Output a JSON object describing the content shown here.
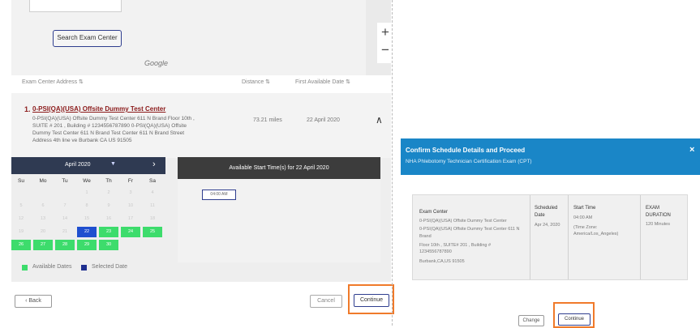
{
  "map": {
    "search_button": "Search Exam Center",
    "google_logo": "Google",
    "zoom_in": "+",
    "zoom_out": "−"
  },
  "table_headers": {
    "address": "Exam Center Address ⇅",
    "distance": "Distance ⇅",
    "first_date": "First Available Date ⇅"
  },
  "result": {
    "number": "1.",
    "name": "0-PSI(QA)(USA) Offsite Dummy Test Center",
    "address_lines": [
      "0-PSI(QA)(USA) Offsite Dummy Test Center 611 N Brand Floor 10th ,",
      "SUITE # 201 , Building # 1234556787890 0-PSI(QA)(USA) Offsite",
      "Dummy Test Center 611 N Brand Test Center 611 N Brand Street",
      "Address 4th line ve Burbank CA US 91505"
    ],
    "distance": "73.21 miles",
    "first_date": "22 April 2020",
    "collapse_glyph": "∧"
  },
  "calendar": {
    "month": "April 2020",
    "dropdown_glyph": "▼",
    "next_glyph": "›",
    "weekdays": [
      "Su",
      "Mo",
      "Tu",
      "We",
      "Th",
      "Fr",
      "Sa"
    ],
    "weeks": [
      [
        "",
        "",
        "",
        "1",
        "2",
        "3",
        "4"
      ],
      [
        "5",
        "6",
        "7",
        "8",
        "9",
        "10",
        "11"
      ],
      [
        "12",
        "13",
        "14",
        "15",
        "16",
        "17",
        "18"
      ],
      [
        "19",
        "20",
        "21",
        "22",
        "23",
        "24",
        "25"
      ],
      [
        "26",
        "27",
        "28",
        "29",
        "30",
        "",
        ""
      ]
    ],
    "available": [
      "22",
      "23",
      "24",
      "25",
      "26",
      "27",
      "28",
      "29",
      "30"
    ],
    "selected": "22",
    "colors": {
      "available": "#3ddc6c",
      "selected": "#1f4fcf"
    }
  },
  "legend": {
    "available": "Available Dates",
    "selected": "Selected Date"
  },
  "times": {
    "header": "Available Start Time(s) for 22 April 2020",
    "slot": "04:00 AM"
  },
  "buttons": {
    "back": "‹ Back",
    "cancel": "Cancel",
    "continue": "Continue"
  },
  "modal": {
    "title": "Confirm Schedule Details and Proceed",
    "subtitle": "NHA Phlebotomy Technician Certification Exam (CPT)",
    "close": "×",
    "columns": {
      "center_h": "Exam Center",
      "center_lines": [
        "0-PSI(QA)(USA) Offsite Dummy Test Center",
        "0-PSI(QA)(USA) Offsite Dummy Test Center 611 N",
        "Brand",
        "Floor 10th , SUITE# 201 , Building #",
        "1234556787890",
        "Burbank,CA,US 91505"
      ],
      "date_h": [
        "Scheduled",
        "Date"
      ],
      "date_v": "Apr 24, 2020",
      "start_h": "Start Time",
      "start_lines": [
        "04:00 AM",
        "",
        "(Time Zone:",
        "America/Los_Angeles)"
      ],
      "duration_h": [
        "EXAM",
        "DURATION"
      ],
      "duration_v": "120 Minutes"
    },
    "change": "Change",
    "continue": "Continue",
    "accent": "#1a86c7"
  }
}
